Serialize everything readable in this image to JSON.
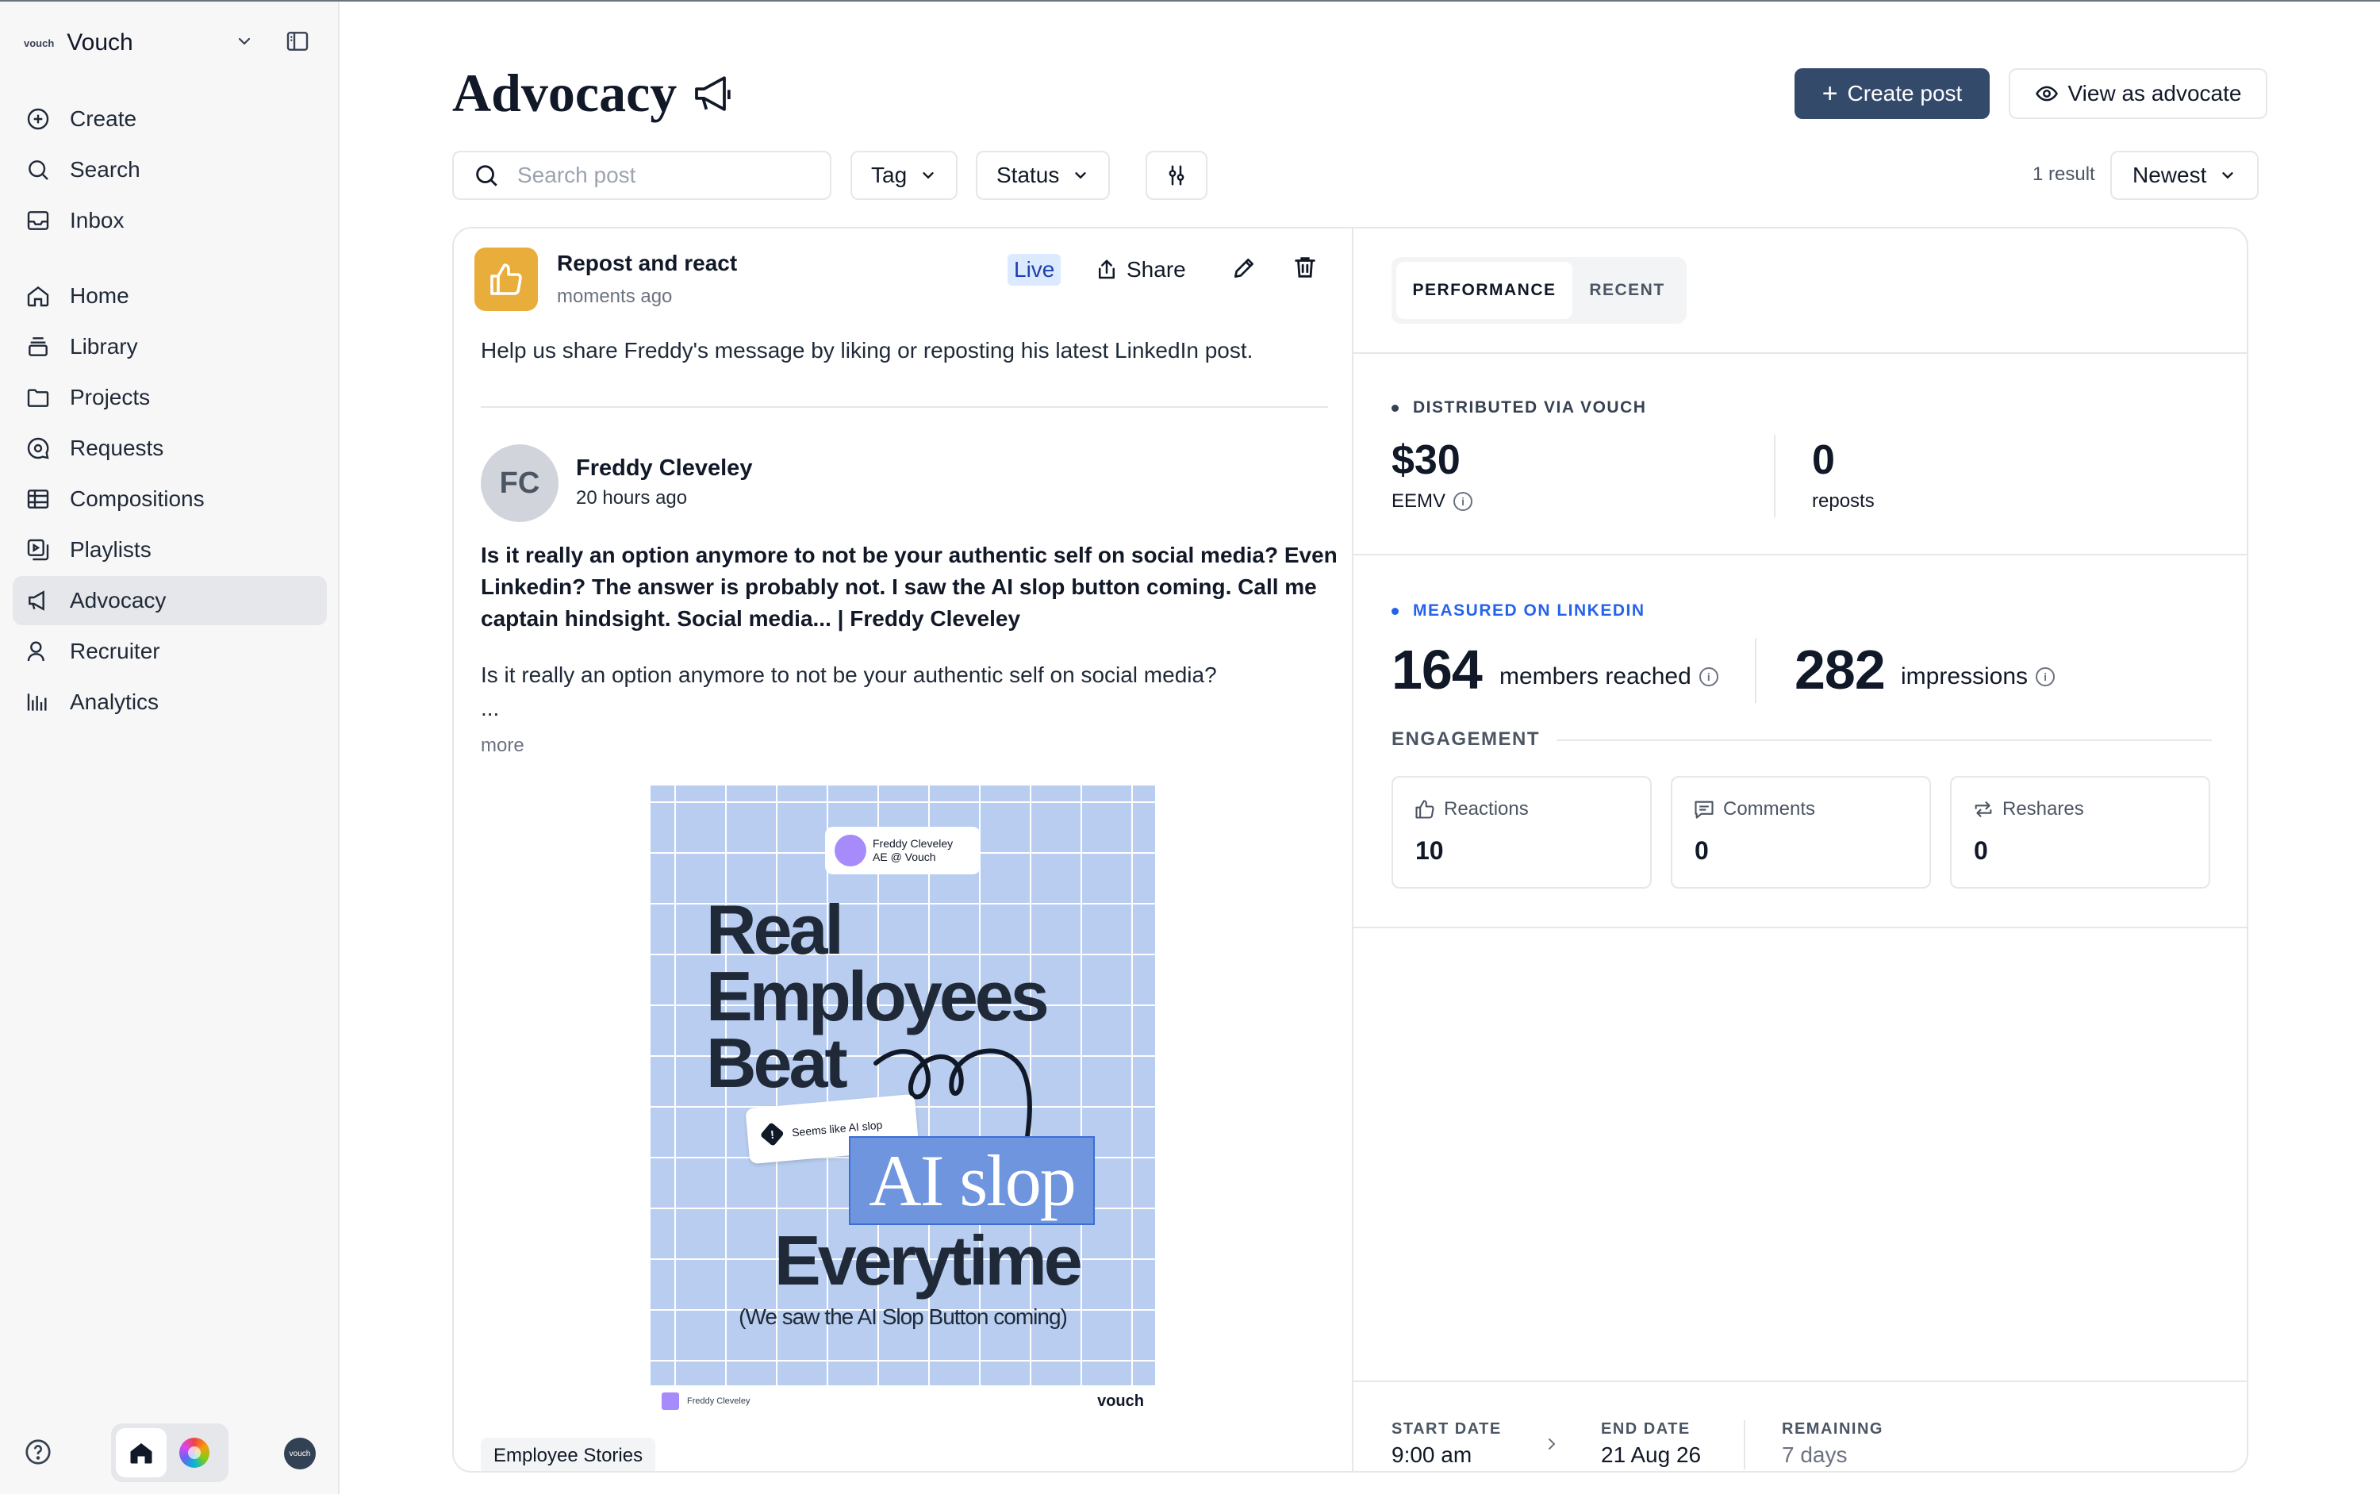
{
  "sidebar": {
    "brand_logo": "vouch",
    "brand_name": "Vouch",
    "nav_primary": [
      {
        "label": "Create",
        "icon": "plus-circle-icon"
      },
      {
        "label": "Search",
        "icon": "search-icon"
      },
      {
        "label": "Inbox",
        "icon": "inbox-icon"
      }
    ],
    "nav_secondary": [
      {
        "label": "Home",
        "icon": "home-icon"
      },
      {
        "label": "Library",
        "icon": "library-icon"
      },
      {
        "label": "Projects",
        "icon": "folder-icon"
      },
      {
        "label": "Requests",
        "icon": "chat-icon"
      },
      {
        "label": "Compositions",
        "icon": "grid-icon"
      },
      {
        "label": "Playlists",
        "icon": "playlist-icon"
      },
      {
        "label": "Advocacy",
        "icon": "megaphone-icon",
        "active": true
      },
      {
        "label": "Recruiter",
        "icon": "user-icon"
      },
      {
        "label": "Analytics",
        "icon": "bar-chart-icon"
      }
    ],
    "avatar_text": "vouch"
  },
  "header": {
    "title": "Advocacy",
    "create_label": "Create post",
    "view_label": "View as advocate"
  },
  "toolbar": {
    "search_placeholder": "Search post",
    "tag_label": "Tag",
    "status_label": "Status",
    "results": "1 result",
    "sort_label": "Newest"
  },
  "post": {
    "title": "Repost and react",
    "time": "moments ago",
    "status": "Live",
    "share_label": "Share",
    "description": "Help us share Freddy's message by liking or reposting his latest LinkedIn post.",
    "linkedin": {
      "initials": "FC",
      "author": "Freddy Cleveley",
      "time": "20 hours ago",
      "headline": "Is it really an option anymore to not be your authentic self on social media? Even Linkedin? The answer is probably not. I saw the AI slop button coming. Call me captain hindsight. Social media... | Freddy Cleveley",
      "body_line": "Is it really an option anymore to not be your authentic self on social media?",
      "ellipsis": "...",
      "more": "more",
      "image": {
        "badge_name": "Freddy Cleveley",
        "badge_role": "AE @ Vouch",
        "line1": "Real",
        "line2": "Employees",
        "line3": "Beat",
        "tag": "Seems like AI slop",
        "highlight": "AI slop",
        "line4": "Everytime",
        "subtitle": "(We saw the AI Slop Button coming)",
        "footer_name": "Freddy Cleveley",
        "footer_brand": "vouch"
      }
    },
    "tag": "Employee Stories"
  },
  "panel": {
    "tab_performance": "PERFORMANCE",
    "tab_recent": "RECENT",
    "distributed_label": "DISTRIBUTED VIA VOUCH",
    "eemv_value": "$30",
    "eemv_label": "EEMV",
    "reposts_value": "0",
    "reposts_label": "reposts",
    "measured_label": "MEASURED ON LINKEDIN",
    "members_value": "164",
    "members_label": "members reached",
    "impressions_value": "282",
    "impressions_label": "impressions",
    "engagement_label": "ENGAGEMENT",
    "engagement": [
      {
        "label": "Reactions",
        "value": "10",
        "icon": "thumbs-up-icon"
      },
      {
        "label": "Comments",
        "value": "0",
        "icon": "comment-icon"
      },
      {
        "label": "Reshares",
        "value": "0",
        "icon": "repost-icon"
      }
    ],
    "start_label": "START DATE",
    "start_value": "9:00 am",
    "end_label": "END DATE",
    "end_value": "21 Aug 26",
    "remaining_label": "REMAINING",
    "remaining_value": "7 days"
  },
  "colors": {
    "primary_button": "#334a6b",
    "post_icon": "#e8ad3a",
    "accent_blue": "#2563eb",
    "live_badge": "#dbeafe",
    "poster_bg": "#b8cdf0"
  }
}
